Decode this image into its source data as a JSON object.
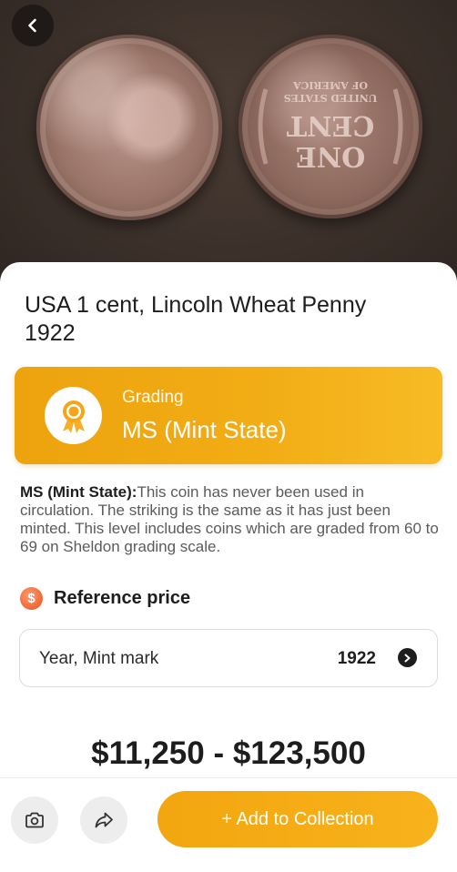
{
  "header": {
    "back_icon": "chevron-left-icon"
  },
  "coin": {
    "title": "USA 1 cent, Lincoln Wheat Penny 1922",
    "reverse_text": [
      "ONE",
      "CENT",
      "UNITED STATES",
      "OF AMERICA"
    ]
  },
  "grading": {
    "label": "Grading",
    "value": "MS (Mint State)",
    "icon": "award-ribbon-icon",
    "colors": {
      "start": "#eda30e",
      "end": "#f7bb25"
    }
  },
  "description": {
    "term": "MS (Mint State):",
    "text": "This coin has never been used in circulation. The striking is the same as it has just been minted. This level includes coins which are graded from 60 to 69 on Sheldon grading scale."
  },
  "reference": {
    "icon": "dollar-coin-icon",
    "title": "Reference price",
    "row_label": "Year, Mint mark",
    "row_value": "1922",
    "row_icon": "chevron-right-circle-icon",
    "price_range": "$11,250 - $123,500"
  },
  "actions": {
    "camera_icon": "camera-icon",
    "share_icon": "share-icon",
    "add_label": "+ Add to Collection"
  }
}
